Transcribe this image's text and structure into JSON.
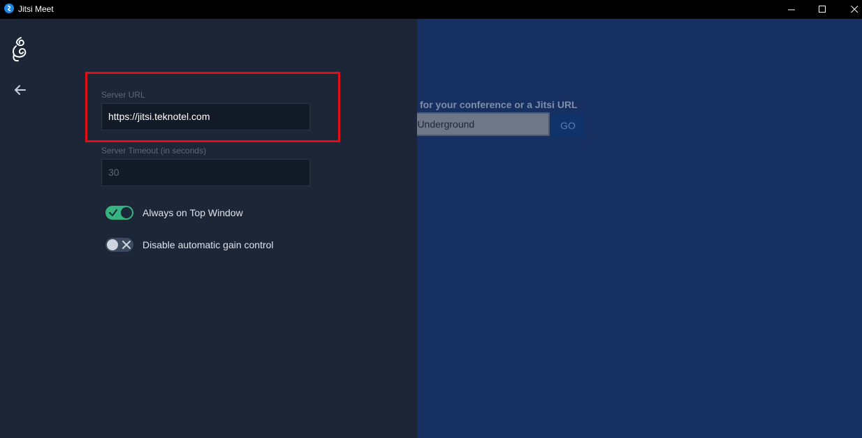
{
  "window": {
    "title": "Jitsi Meet"
  },
  "settings": {
    "server_url": {
      "label": "Server URL",
      "value": "https://jitsi.teknotel.com"
    },
    "server_timeout": {
      "label": "Server Timeout (in seconds)",
      "value": "30"
    },
    "always_on_top": {
      "label": "Always on Top Window",
      "enabled": true
    },
    "disable_agc": {
      "label": "Disable automatic gain control",
      "enabled": false
    }
  },
  "home": {
    "prompt": "for your conference or a Jitsi URL",
    "room_input_value": "erUnderground",
    "go_label": "GO"
  },
  "colors": {
    "drawer_bg": "#1c2637",
    "home_bg": "#163161",
    "toggle_on": "#36b37e",
    "highlight_border": "#e30d18"
  }
}
